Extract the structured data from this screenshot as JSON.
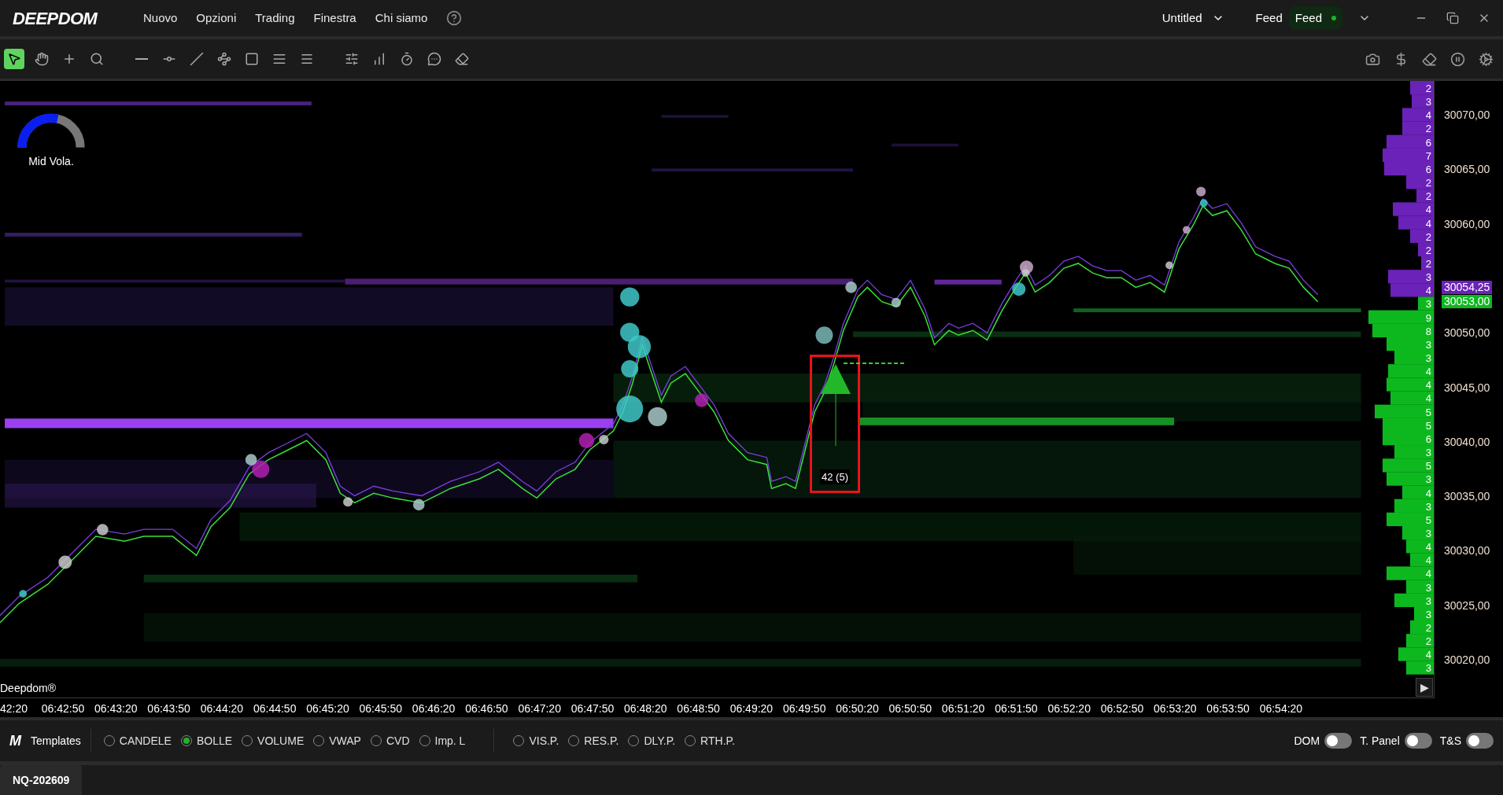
{
  "app": {
    "logo": "DEEPDOM",
    "menu": [
      "Nuovo",
      "Opzioni",
      "Trading",
      "Finestra",
      "Chi siamo"
    ],
    "layout_name": "Untitled",
    "feed_label": "Feed",
    "feed_status": {
      "label": "Feed",
      "connected": true
    }
  },
  "toolbar": {
    "tools": [
      {
        "kind": "select",
        "selected": true
      },
      {
        "kind": "hand",
        "selected": false
      },
      {
        "kind": "cross",
        "selected": false
      },
      {
        "kind": "zoom",
        "selected": false
      },
      {
        "kind": "hline",
        "selected": false
      },
      {
        "kind": "ray",
        "selected": false
      },
      {
        "kind": "line",
        "selected": false
      },
      {
        "kind": "path",
        "selected": false
      },
      {
        "kind": "rect",
        "selected": false
      },
      {
        "kind": "lines",
        "selected": false
      },
      {
        "kind": "lines2",
        "selected": false
      },
      {
        "kind": "sliders",
        "selected": false
      },
      {
        "kind": "bars",
        "selected": false
      },
      {
        "kind": "timer",
        "selected": false
      },
      {
        "kind": "comment",
        "selected": false
      },
      {
        "kind": "eraser",
        "selected": false
      }
    ],
    "actions": [
      {
        "kind": "camera"
      },
      {
        "kind": "dollar"
      },
      {
        "kind": "eraser"
      },
      {
        "kind": "pause"
      },
      {
        "kind": "settings"
      }
    ]
  },
  "chart": {
    "indicator": {
      "label": "Mid Vola.",
      "level": 0.65
    },
    "trade_marker": {
      "label": "42 (5)"
    },
    "brand": "Deepdom®",
    "price_labels_upper": [
      "30070,00",
      "30065,00",
      "30060,00"
    ],
    "price_labels_lower": [
      "30050,00",
      "30045,00",
      "30040,00",
      "30035,00",
      "30030,00",
      "30025,00",
      "30020,00"
    ],
    "last_prices": [
      {
        "label": "30054,25",
        "color": "#6a22b8"
      },
      {
        "label": "30053,00",
        "color": "#0db81f"
      }
    ],
    "profile": {
      "ask_counts": [
        "2",
        "3",
        "4",
        "2",
        "6",
        "7",
        "6",
        "2",
        "2",
        "4",
        "4",
        "2",
        "2",
        "2",
        "3",
        "4"
      ],
      "bid_counts": [
        "3",
        "9",
        "8",
        "3",
        "3",
        "4",
        "4",
        "4",
        "5",
        "5",
        "6",
        "3",
        "5",
        "3",
        "4",
        "3",
        "5",
        "3",
        "4",
        "4",
        "4",
        "3",
        "3",
        "3",
        "2",
        "2",
        "4",
        "3"
      ]
    },
    "scroll_button": "▶",
    "time_labels": [
      "42:20",
      "06:42:50",
      "06:43:20",
      "06:43:50",
      "06:44:20",
      "06:44:50",
      "06:45:20",
      "06:45:50",
      "06:46:20",
      "06:46:50",
      "06:47:20",
      "06:47:50",
      "06:48:20",
      "06:48:50",
      "06:49:20",
      "06:49:50",
      "06:50:20",
      "06:50:50",
      "06:51:20",
      "06:51:50",
      "06:52:20",
      "06:52:50",
      "06:53:20",
      "06:53:50",
      "06:54:20"
    ]
  },
  "bottom_bar": {
    "templates_logo": "M",
    "templates_label": "Templates",
    "chart_types": [
      {
        "label": "CANDELE",
        "selected": false
      },
      {
        "label": "BOLLE",
        "selected": true
      },
      {
        "label": "VOLUME",
        "selected": false
      },
      {
        "label": "VWAP",
        "selected": false
      },
      {
        "label": "CVD",
        "selected": false
      },
      {
        "label": "Imp. L",
        "selected": false
      }
    ],
    "profiles": [
      {
        "label": "VIS.P.",
        "selected": false
      },
      {
        "label": "RES.P.",
        "selected": false
      },
      {
        "label": "DLY.P.",
        "selected": false
      },
      {
        "label": "RTH.P.",
        "selected": false
      }
    ],
    "toggles": [
      {
        "label": "DOM",
        "on": false
      },
      {
        "label": "T. Panel",
        "on": false
      },
      {
        "label": "T&S",
        "on": false
      }
    ]
  },
  "tabs": [
    {
      "label": "NQ-202609",
      "selected": true
    }
  ]
}
